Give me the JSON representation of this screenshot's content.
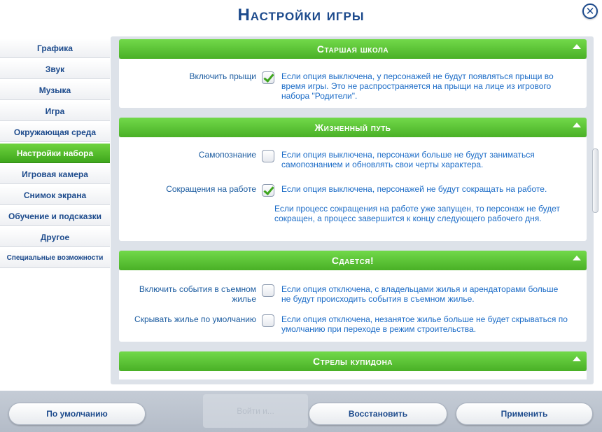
{
  "window": {
    "title": "Настройки игры",
    "close_symbol": "✕"
  },
  "sidebar": {
    "items": [
      {
        "label": "Графика",
        "active": false
      },
      {
        "label": "Звук",
        "active": false
      },
      {
        "label": "Музыка",
        "active": false
      },
      {
        "label": "Игра",
        "active": false
      },
      {
        "label": "Окружающая среда",
        "active": false
      },
      {
        "label": "Настройки набора",
        "active": true
      },
      {
        "label": "Игровая камера",
        "active": false
      },
      {
        "label": "Снимок экрана",
        "active": false
      },
      {
        "label": "Обучение и подсказки",
        "active": false
      },
      {
        "label": "Другое",
        "active": false
      },
      {
        "label": "Специальные возможности",
        "active": false
      }
    ]
  },
  "sections": [
    {
      "header": "Старшая школа",
      "rows": [
        {
          "label": "Включить прыщи",
          "checked": true,
          "desc": "Если опция выключена, у персонажей не будут появляться прыщи во время игры. Это не распространяется на прыщи на лице из игрового набора \"Родители\"."
        }
      ]
    },
    {
      "header": "Жизненный путь",
      "rows": [
        {
          "label": "Самопознание",
          "checked": false,
          "desc": "Если опция выключена, персонажи больше не будут заниматься самопознанием и обновлять свои черты характера."
        },
        {
          "label": "Сокращения на работе",
          "checked": true,
          "desc": "Если опция выключена, персонажей не будут сокращать на работе.",
          "desc2": "Если процесс сокращения на работе уже запущен, то персонаж не будет сокращен, а процесс завершится к концу следующего рабочего дня."
        }
      ]
    },
    {
      "header": "Сдается!",
      "rows": [
        {
          "label": "Включить события в съемном жилье",
          "checked": false,
          "desc": "Если опция отключена, с владельцами жилья и арендаторами больше не будут происходить события в съемном жилье."
        },
        {
          "label": "Скрывать жилье по умолчанию",
          "checked": false,
          "desc": "Если опция отключена, незанятое жилье больше не будет скрываться по умолчанию при переходе в режим строительства."
        }
      ]
    },
    {
      "header": "Стрелы купидона",
      "rows": []
    }
  ],
  "footer": {
    "ghost_label": "Войти и...",
    "default_button": "По умолчанию",
    "restore_button": "Восстановить",
    "apply_button": "Применить"
  },
  "colors": {
    "accent_green": "#4fb82a",
    "title_blue": "#1c4a8c",
    "desc_blue": "#1c6cc7"
  }
}
